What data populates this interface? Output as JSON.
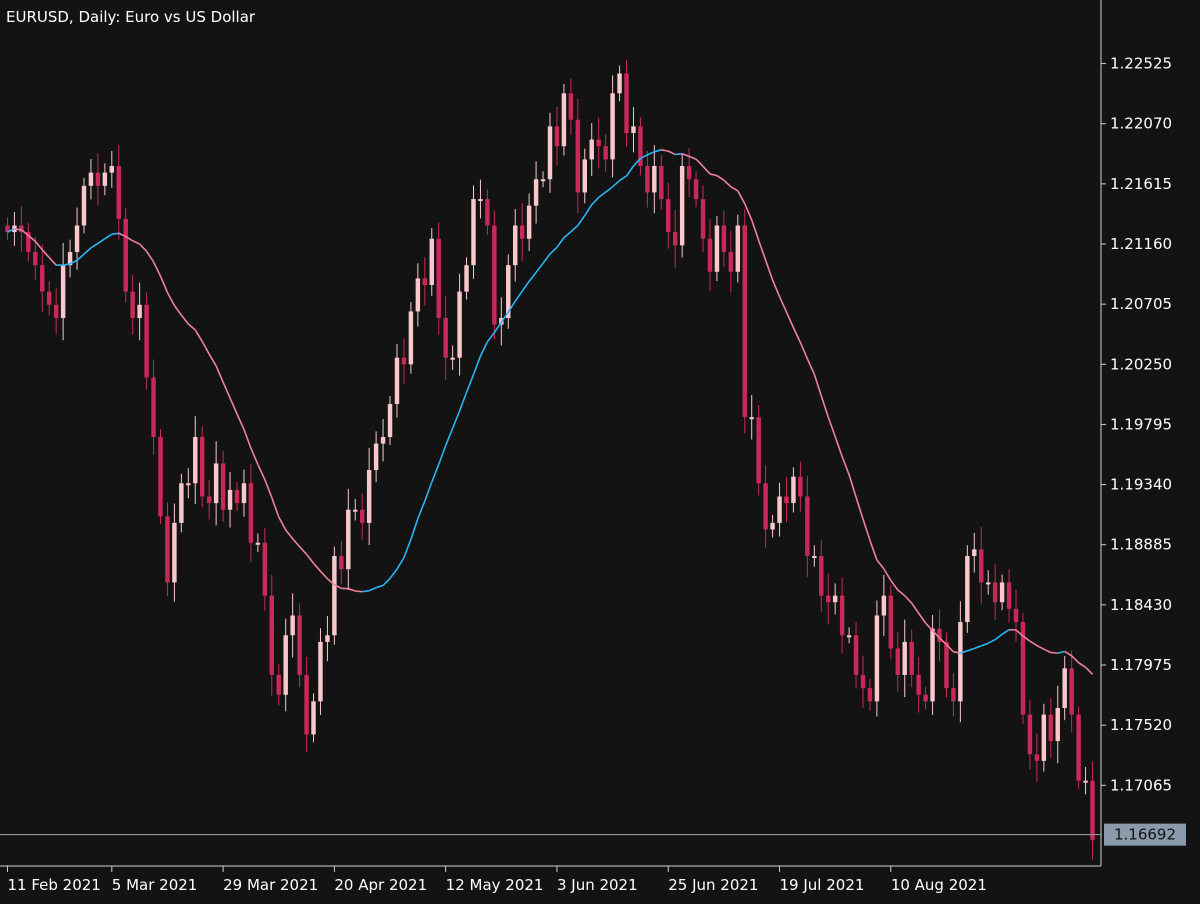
{
  "chart_data": {
    "type": "candlestick",
    "title": "EURUSD, Daily:  Euro vs US Dollar",
    "symbol": "EURUSD",
    "timeframe": "Daily",
    "description": "Euro vs US Dollar",
    "current_price": "1.16692",
    "ylim": [
      1.165,
      1.229
    ],
    "grid": false,
    "y_ticks": [
      "1.22525",
      "1.22070",
      "1.21615",
      "1.21160",
      "1.20705",
      "1.20250",
      "1.19795",
      "1.19340",
      "1.18885",
      "1.18430",
      "1.17975",
      "1.17520",
      "1.17065"
    ],
    "x_ticks": [
      {
        "label": "11 Feb 2021",
        "index": 0
      },
      {
        "label": "5 Mar 2021",
        "index": 15
      },
      {
        "label": "29 Mar 2021",
        "index": 31
      },
      {
        "label": "20 Apr 2021",
        "index": 47
      },
      {
        "label": "12 May 2021",
        "index": 63
      },
      {
        "label": "3 Jun 2021",
        "index": 79
      },
      {
        "label": "25 Jun 2021",
        "index": 95
      },
      {
        "label": "19 Jul 2021",
        "index": 111
      },
      {
        "label": "10 Aug 2021",
        "index": 127
      }
    ],
    "closes": [
      1.2125,
      1.213,
      1.2125,
      1.211,
      1.21,
      1.208,
      1.207,
      1.206,
      1.21,
      1.211,
      1.213,
      1.216,
      1.217,
      1.216,
      1.217,
      1.2175,
      1.2135,
      1.208,
      1.206,
      1.207,
      1.2015,
      1.197,
      1.191,
      1.186,
      1.1905,
      1.1935,
      1.1935,
      1.197,
      1.1925,
      1.192,
      1.195,
      1.1915,
      1.193,
      1.192,
      1.1935,
      1.189,
      1.189,
      1.185,
      1.179,
      1.1775,
      1.182,
      1.1835,
      1.179,
      1.1745,
      1.177,
      1.1815,
      1.182,
      1.188,
      1.187,
      1.1915,
      1.1915,
      1.1905,
      1.1945,
      1.1965,
      1.197,
      1.1995,
      1.203,
      1.2025,
      1.2065,
      1.209,
      1.2085,
      1.212,
      1.206,
      1.203,
      1.203,
      1.208,
      1.21,
      1.215,
      1.215,
      1.213,
      1.2055,
      1.206,
      1.21,
      1.213,
      1.212,
      1.2145,
      1.2165,
      1.2165,
      1.2205,
      1.219,
      1.223,
      1.221,
      1.2155,
      1.218,
      1.2195,
      1.219,
      1.218,
      1.223,
      1.2245,
      1.22,
      1.2205,
      1.2175,
      1.2155,
      1.2175,
      1.215,
      1.2125,
      1.2115,
      1.2175,
      1.2165,
      1.215,
      1.212,
      1.2095,
      1.213,
      1.211,
      1.2095,
      1.213,
      1.1985,
      1.1985,
      1.1935,
      1.19,
      1.1905,
      1.1925,
      1.192,
      1.194,
      1.1925,
      1.188,
      1.188,
      1.185,
      1.1845,
      1.185,
      1.182,
      1.182,
      1.179,
      1.178,
      1.177,
      1.1835,
      1.185,
      1.181,
      1.179,
      1.1815,
      1.179,
      1.1775,
      1.177,
      1.1825,
      1.1815,
      1.178,
      1.177,
      1.183,
      1.188,
      1.1885,
      1.186,
      1.186,
      1.1845,
      1.186,
      1.184,
      1.183,
      1.176,
      1.173,
      1.1725,
      1.176,
      1.174,
      1.1765,
      1.1795,
      1.176,
      1.171,
      1.171,
      1.1665
    ],
    "ma_period": 20,
    "ma_colors": {
      "up": "#29b6f6",
      "down": "#f080a0"
    },
    "colors": {
      "background": "#131313",
      "bull_candle": "#f8c8cc",
      "bear_candle": "#c8285a",
      "axis": "#d0d0d0",
      "text": "#ffffff",
      "price_label_bg": "#8a9aaa"
    }
  }
}
